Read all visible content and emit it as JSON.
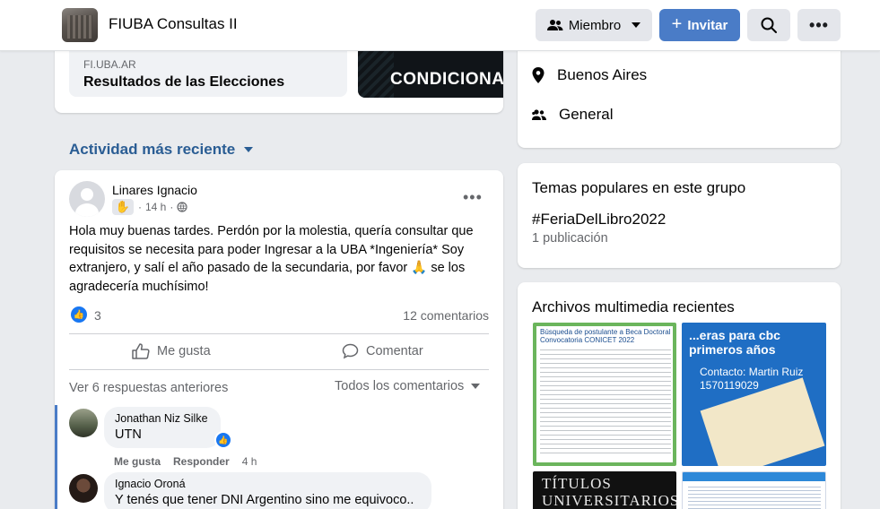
{
  "header": {
    "group_name": "FIUBA Consultas II",
    "member_label": "Miembro",
    "invite_label": "Invitar"
  },
  "top_card": {
    "link_domain": "FI.UBA.AR",
    "link_title": "Resultados de las Elecciones",
    "promo_text": "CONDICIONA"
  },
  "feed": {
    "sort_label": "Actividad más reciente"
  },
  "post": {
    "author": "Linares Ignacio",
    "time": "14 h",
    "text": "Hola muy buenas tardes. Perdón por la molestia, quería consultar que requisitos se necesita para poder Ingresar a la UBA *Ingeniería* Soy extranjero, y salí el año pasado de la secundaria, por favor 🙏 se los agradecería muchísimo!",
    "reaction_count": "3",
    "comments_count": "12 comentarios",
    "like_label": "Me gusta",
    "comment_label": "Comentar",
    "prev_replies": "Ver 6 respuestas anteriores",
    "all_comments": "Todos los comentarios"
  },
  "comments": [
    {
      "name": "Jonathan Niz Silke",
      "text": "UTN",
      "like": "Me gusta",
      "reply": "Responder",
      "time": "4 h"
    },
    {
      "name": "Ignacio Oroná",
      "text": "Y tenés que tener DNI Argentino sino me equivoco.."
    }
  ],
  "sidebar": {
    "location": "Buenos Aires",
    "category": "General",
    "topics_title": "Temas populares en este grupo",
    "hashtag": "#FeriaDelLibro2022",
    "hashtag_count": "1 publicación",
    "media_title": "Archivos multimedia recientes",
    "media": {
      "t1_title": "Búsqueda de postulante a Beca Doctoral Convocatoria CONICET 2022",
      "t2_head": "...eras para cbc primeros años",
      "t2_contact": "Contacto: Martin Ruiz 1570119029",
      "t3_text": "TÍTULOS UNIVERSITARIOS"
    }
  },
  "colors": {
    "accent": "#4a7cc7",
    "link_blue": "#2a5d94",
    "like_blue": "#1877f2"
  }
}
